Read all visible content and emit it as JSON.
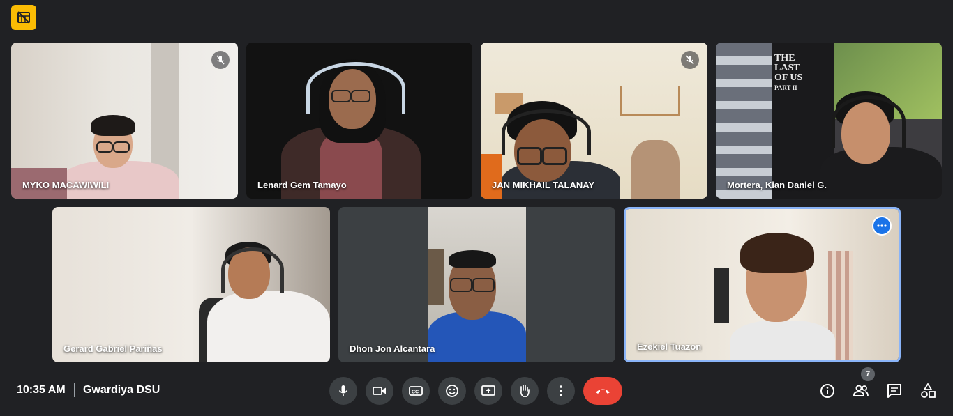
{
  "meeting": {
    "time": "10:35 AM",
    "separator": "|",
    "title": "Gwardiya DSU"
  },
  "participants": [
    {
      "name": "MYKO MACAWIWILI",
      "muted": true
    },
    {
      "name": "Lenard Gem Tamayo",
      "muted": false
    },
    {
      "name": "JAN MIKHAIL TALANAY",
      "muted": true
    },
    {
      "name": "Mortera, Kian Daniel G.",
      "muted": false
    },
    {
      "name": "Gerard Gabriel Pariñas",
      "muted": false
    },
    {
      "name": "Dhon Jon Alcantara",
      "muted": false
    },
    {
      "name": "Ezekiel Tuazon",
      "muted": false,
      "active": true
    }
  ],
  "poster": {
    "line1": "THE",
    "line2": "LAST",
    "line3": "OF US",
    "line4": "PART II"
  },
  "people_count": "7",
  "controls": [
    {
      "icon": "mic-icon"
    },
    {
      "icon": "camera-icon"
    },
    {
      "icon": "captions-icon"
    },
    {
      "icon": "emoji-icon"
    },
    {
      "icon": "present-icon"
    },
    {
      "icon": "raise-hand-icon"
    },
    {
      "icon": "more-options-icon"
    },
    {
      "icon": "end-call-icon"
    }
  ],
  "right_controls": [
    {
      "icon": "info-icon"
    },
    {
      "icon": "people-icon"
    },
    {
      "icon": "chat-icon"
    },
    {
      "icon": "activities-icon"
    }
  ],
  "colors": {
    "accent": "#1a73e8",
    "end_call": "#ea4335",
    "background": "#202124",
    "badge": "#fbbc04"
  }
}
